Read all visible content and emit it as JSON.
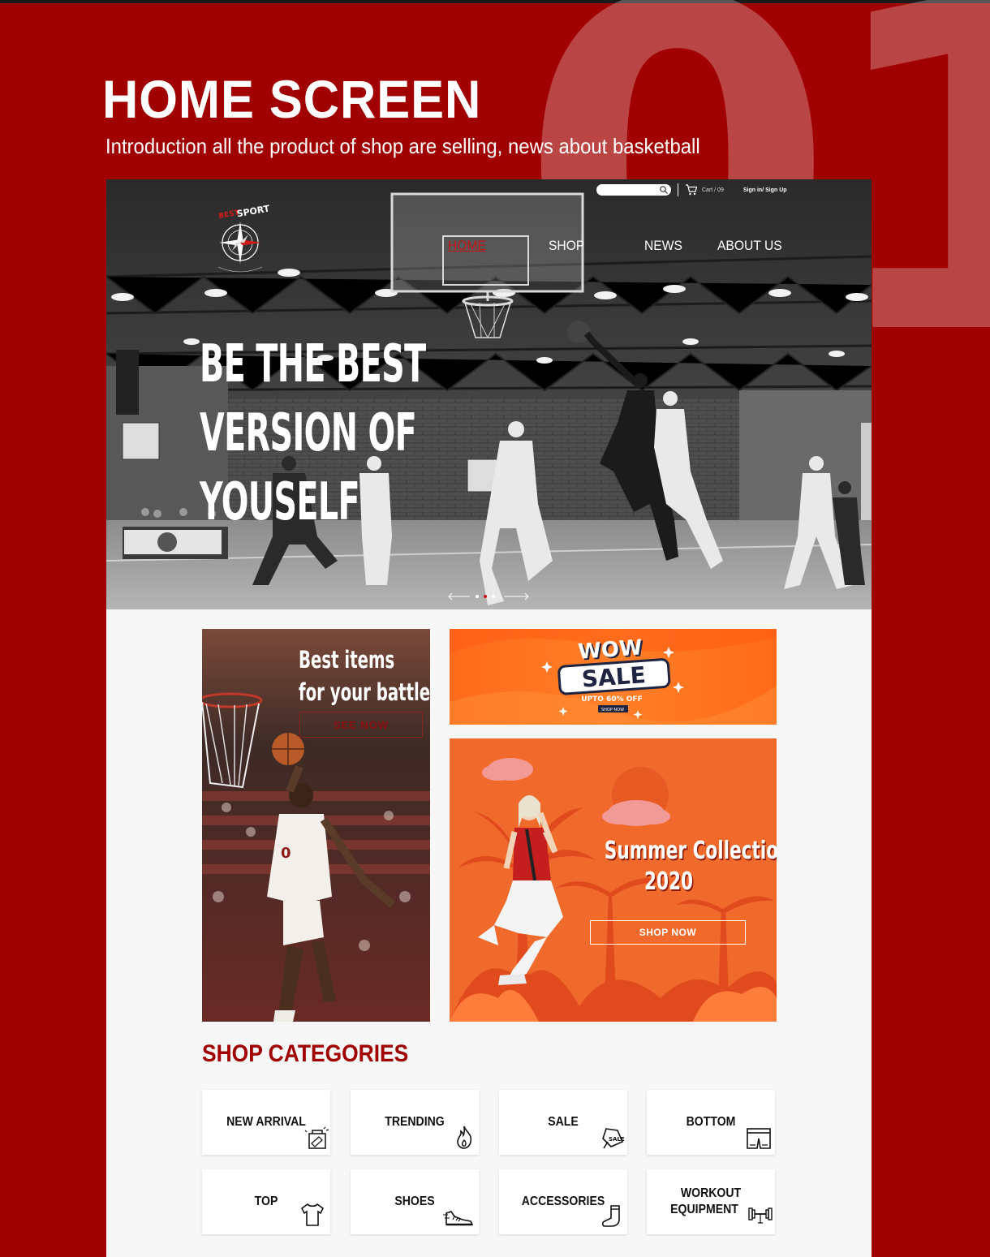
{
  "section": {
    "number": "01",
    "title": "HOME SCREEN",
    "subtitle": "Introduction all the product of shop are selling, news about basketball"
  },
  "header": {
    "search_placeholder": "",
    "cart_label": "Cart / 09",
    "auth_label": "Sign in/ Sign Up",
    "logo_text": "SPORT",
    "nav": [
      {
        "label": "HOME",
        "active": true
      },
      {
        "label": "SHOP",
        "active": false
      },
      {
        "label": "NEWS",
        "active": false
      },
      {
        "label": "ABOUT US",
        "active": false
      }
    ]
  },
  "hero": {
    "headline": [
      "BE THE BEST",
      "VERSION OF",
      "YOUSELF"
    ]
  },
  "promos": {
    "left": {
      "line1": "Best items",
      "line2": "for your battles",
      "button": "SEE NOW"
    },
    "sale": {
      "wow": "WOW",
      "sale": "SALE",
      "upto": "UPTO 60% OFF",
      "button": "SHOP NOW"
    },
    "summer": {
      "line1": "Summer Collection",
      "line2": "2020",
      "button": "SHOP NOW"
    }
  },
  "categories": {
    "title": "SHOP CATEGORIES",
    "items": [
      {
        "label": "NEW ARRIVAL",
        "icon": "new-arrival-icon"
      },
      {
        "label": "TRENDING",
        "icon": "fire-icon"
      },
      {
        "label": "SALE",
        "icon": "sale-tag-icon"
      },
      {
        "label": "BOTTOM",
        "icon": "shorts-icon"
      },
      {
        "label": "TOP",
        "icon": "tshirt-icon"
      },
      {
        "label": "SHOES",
        "icon": "sneaker-icon"
      },
      {
        "label": "ACCESSORIES",
        "icon": "sock-icon"
      },
      {
        "label": "WORKOUT EQUIPMENT",
        "line1": "WORKOUT",
        "line2": "EQUIPMENT",
        "icon": "dumbbell-icon"
      }
    ]
  },
  "colors": {
    "brand_red": "#a10000",
    "accent_orange": "#f0662a"
  }
}
